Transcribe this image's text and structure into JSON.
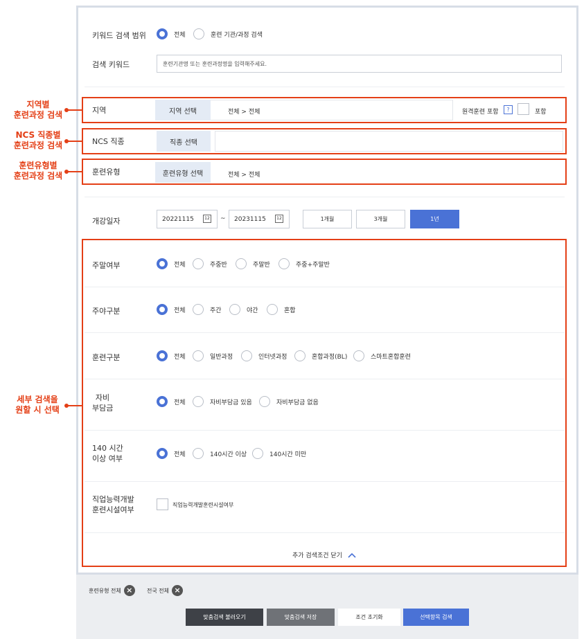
{
  "search": {
    "keyword_range_label": "키워드 검색 범위",
    "range_options": [
      "전체",
      "훈련 기관/과정 검색"
    ],
    "keyword_label": "검색 키워드",
    "keyword_placeholder": "훈련기관명 또는 훈련과정명을 입력해주세요."
  },
  "region": {
    "label": "지역",
    "button": "지역 선택",
    "value": "전체 > 전체",
    "remote_label": "원격훈련 포함",
    "help": "?",
    "include_label": "포함"
  },
  "ncs": {
    "label": "NCS 직종",
    "button": "직종 선택",
    "value": ""
  },
  "training_type": {
    "label": "훈련유형",
    "button": "훈련유형 선택",
    "value": "전체 > 전체"
  },
  "period": {
    "label": "개강일자",
    "start": "20221115",
    "end": "20231115",
    "tilde": "~",
    "cal_icon": "12",
    "buttons": [
      "1개월",
      "3개월",
      "1년"
    ],
    "selected": "1년"
  },
  "details": {
    "weekend": {
      "label": "주말여부",
      "options": [
        "전체",
        "주중반",
        "주말반",
        "주중+주말반"
      ]
    },
    "daynight": {
      "label": "주야구분",
      "options": [
        "전체",
        "주간",
        "야간",
        "혼합"
      ]
    },
    "training": {
      "label": "훈련구분",
      "options": [
        "전체",
        "일반과정",
        "인터넷과정",
        "혼합과정(BL)",
        "스마트혼합훈련"
      ]
    },
    "selfpay": {
      "label_1": "자비",
      "label_2": "부담금",
      "options": [
        "전체",
        "자비부담금 있음",
        "자비부담금 없음"
      ]
    },
    "hours": {
      "label_1": "140 시간",
      "label_2": "이상 여부",
      "options": [
        "전체",
        "140시간 이상",
        "140시간 미만"
      ]
    },
    "facility": {
      "label_1": "직업능력개발",
      "label_2": "훈련시설여부",
      "checkbox_label": "직업능력개발훈련시설여부"
    },
    "close_label": "추가 검색조건 닫기"
  },
  "callouts": {
    "region": [
      "지역별",
      "훈련과정 검색"
    ],
    "ncs": [
      "NCS 직종별",
      "훈련과정 검색"
    ],
    "type": [
      "훈련유형별",
      "훈련과정 검색"
    ],
    "detail": [
      "세부 검색을",
      "원할 시 선택"
    ]
  },
  "tags": [
    "훈련유형 전체",
    "전국 전체"
  ],
  "bottom_buttons": [
    "맞춤검색 불러오기",
    "맞춤검색 저장",
    "조건 초기화",
    "선택항목 검색"
  ],
  "colors": {
    "accent": "#4a72d6",
    "annotation": "#e43f16",
    "dark_button": "#3e4147",
    "mid_button": "#6f7277"
  }
}
